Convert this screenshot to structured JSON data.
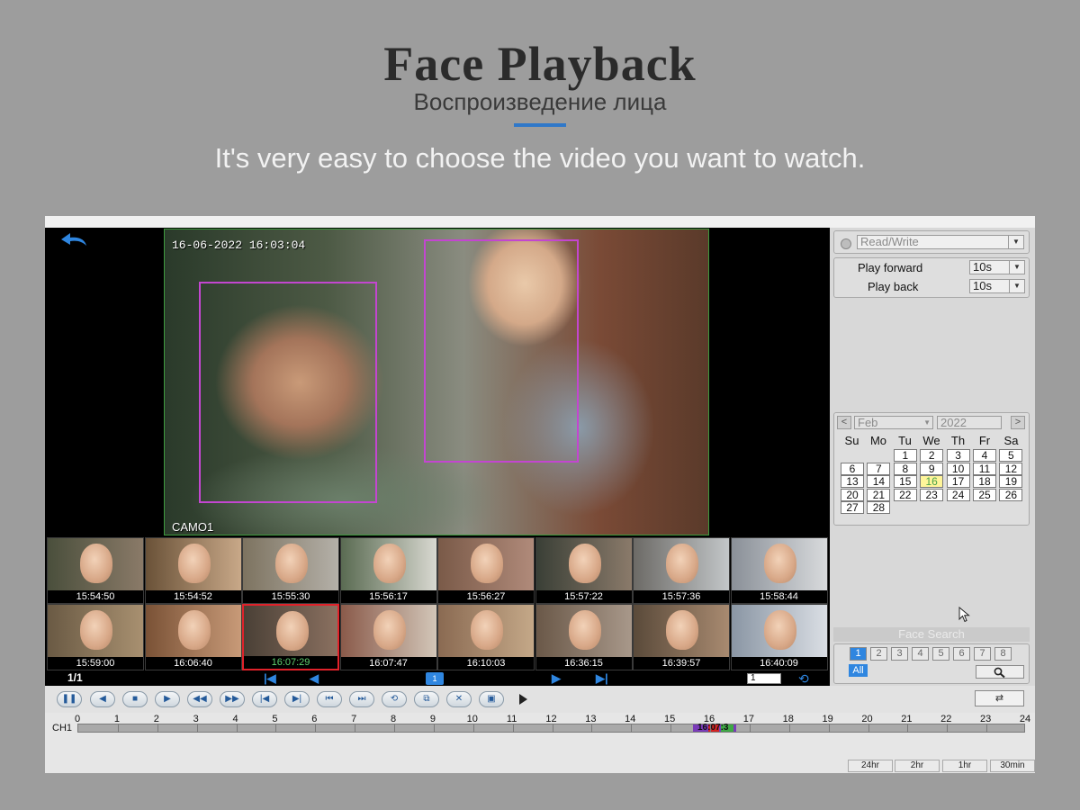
{
  "banner": {
    "title": "Face Playback",
    "subtitle": "Воспроизведение лица",
    "tagline": "It's very easy to choose the video you want to watch."
  },
  "player": {
    "timestamp": "16-06-2022 16:03:04",
    "camera": "CAMO1"
  },
  "thumbnails": [
    {
      "time": "15:54:50"
    },
    {
      "time": "15:54:52"
    },
    {
      "time": "15:55:30"
    },
    {
      "time": "15:56:17"
    },
    {
      "time": "15:56:27"
    },
    {
      "time": "15:57:22"
    },
    {
      "time": "15:57:36"
    },
    {
      "time": "15:58:44"
    },
    {
      "time": "15:59:00"
    },
    {
      "time": "16:06:40"
    },
    {
      "time": "16:07:29"
    },
    {
      "time": "16:07:47"
    },
    {
      "time": "16:10:03"
    },
    {
      "time": "16:36:15"
    },
    {
      "time": "16:39:57"
    },
    {
      "time": "16:40:09"
    }
  ],
  "thumb_nav": {
    "page_count": "1/1",
    "page_number": "1",
    "page_input": "1"
  },
  "panel": {
    "mode": "Read/Write",
    "play_forward_label": "Play forward",
    "play_forward_value": "10s",
    "play_back_label": "Play back",
    "play_back_value": "10s"
  },
  "calendar": {
    "month": "Feb",
    "year": "2022",
    "prev": "<",
    "next": ">",
    "weekdays": [
      "Su",
      "Mo",
      "Tu",
      "We",
      "Th",
      "Fr",
      "Sa"
    ],
    "days": [
      "1",
      "2",
      "3",
      "4",
      "5",
      "6",
      "7",
      "8",
      "9",
      "10",
      "11",
      "12",
      "13",
      "14",
      "15",
      "16",
      "17",
      "18",
      "19",
      "20",
      "21",
      "22",
      "23",
      "24",
      "25",
      "26",
      "27",
      "28"
    ],
    "highlight": "16"
  },
  "face_search": {
    "title": "Face Search",
    "channels": [
      "1",
      "2",
      "3",
      "4",
      "5",
      "6",
      "7",
      "8"
    ],
    "all_label": "All"
  },
  "timeline": {
    "channel": "CH1",
    "hours": [
      "0",
      "1",
      "2",
      "3",
      "4",
      "5",
      "6",
      "7",
      "8",
      "9",
      "10",
      "11",
      "12",
      "13",
      "14",
      "15",
      "16",
      "17",
      "18",
      "19",
      "20",
      "21",
      "22",
      "23",
      "24"
    ],
    "marker_text": "16:07:3",
    "zoom": [
      "24hr",
      "2hr",
      "1hr",
      "30min"
    ]
  },
  "colors": {
    "accent": "#2f86e0",
    "face_box": "#c346d0",
    "selected": "#e0222a",
    "highlight": "#fff59a"
  }
}
